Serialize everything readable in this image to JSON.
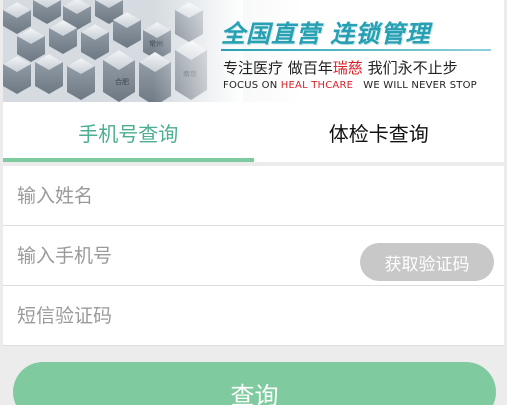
{
  "banner": {
    "slogan_main": "全国直营 连锁管理",
    "slogan_sub_a": "专注医疗 做百年",
    "slogan_sub_brand": "瑞慈",
    "slogan_sub_b": " 我们永不止步",
    "slogan_en_a": "FOCUS ON ",
    "slogan_en_highlight": "HEAL THCARE",
    "slogan_en_b": "   WE WILL NEVER STOP",
    "cube_label_1": "合肥",
    "cube_label_2": "常州",
    "cube_label_3": "南京",
    "colors": {
      "accent": "#26a0b2",
      "brand_red": "#d9222a"
    }
  },
  "tabs": [
    {
      "label": "手机号查询",
      "active": true
    },
    {
      "label": "体检卡查询",
      "active": false
    }
  ],
  "form": {
    "name_placeholder": "输入姓名",
    "phone_placeholder": "输入手机号",
    "code_placeholder": "短信验证码",
    "get_code_label": "获取验证码"
  },
  "submit": {
    "label": "查询"
  },
  "colors": {
    "primary_green": "#7fcb9f",
    "active_tab_text": "#4cae92",
    "disabled_button": "#c8c8c8"
  }
}
